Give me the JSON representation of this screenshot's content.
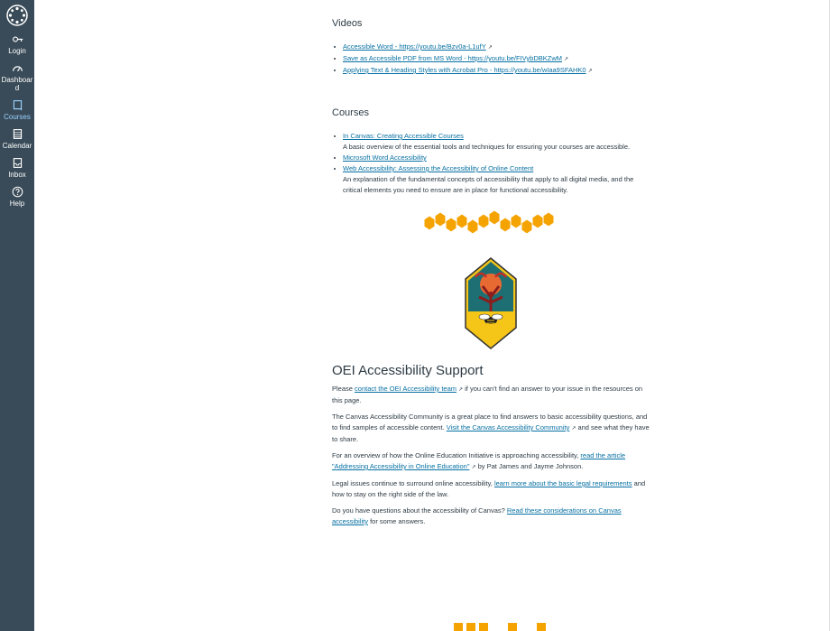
{
  "nav": {
    "items": [
      {
        "label": "Login",
        "icon": "login-icon"
      },
      {
        "label": "Dashboard",
        "icon": "dashboard-icon"
      },
      {
        "label": "Courses",
        "icon": "courses-icon"
      },
      {
        "label": "Calendar",
        "icon": "calendar-icon"
      },
      {
        "label": "Inbox",
        "icon": "inbox-icon"
      },
      {
        "label": "Help",
        "icon": "help-icon"
      }
    ],
    "active": "Courses"
  },
  "videos": {
    "heading": "Videos",
    "items": [
      "Accessible Word - https://youtu.be/Bzv0a-L1ufY",
      "Save as Accessible PDF from MS Word - https://youtu.be/FIVybDBKZwM",
      "Applying Text & Heading Styles with Acrobat Pro - https://youtu.be/wIaa9SFAHK0"
    ]
  },
  "courses": {
    "heading": "Courses",
    "items": [
      {
        "link": "In Canvas: Creating Accessible Courses",
        "desc": "A basic overview of the essential tools and techniques for ensuring your courses are accessible."
      },
      {
        "link": "Microsoft Word Accessibility",
        "desc": ""
      },
      {
        "link": "Web Accessibility: Assessing the Accessibility of Online Content",
        "desc": "An explanation of the fundamental concepts of accessibility that apply to all digital media, and the critical elements you need to ensure are in place for functional accessibility."
      }
    ]
  },
  "support": {
    "heading": "OEI Accessibility Support",
    "p1": {
      "pre": "Please ",
      "link": "contact the OEI Accessibility team",
      "post": " if you can't find an answer to your issue in the resources on this page."
    },
    "p2": {
      "pre": "The Canvas Accessibility Community is a great place to find answers to basic accessibility questions, and to find samples of accessible content. ",
      "link": "Visit the Canvas Accessibility Community",
      "post": " and see what they have to share."
    },
    "p3": {
      "pre": "For an overview of how the Online Education Initiative is approaching accessibility, ",
      "link": "read the article \"Addressing Accessibility in Online Education\"",
      "post": " by Pat James and Jayme Johnson."
    },
    "p4": {
      "pre": "Legal issues continue to surround online accessibility, ",
      "link": "learn more about the basic legal requirements",
      "post": " and how to stay on the right side of the law."
    },
    "p5": {
      "pre": "Do you have questions about the accessibility of Canvas? ",
      "link": "Read these considerations on Canvas accessibility",
      "post": " for some answers."
    }
  },
  "colors": {
    "nav_bg": "#394b58",
    "link": "#0770a3",
    "honeycomb": "#f5a300",
    "badge_bg": "#1d6f73"
  }
}
